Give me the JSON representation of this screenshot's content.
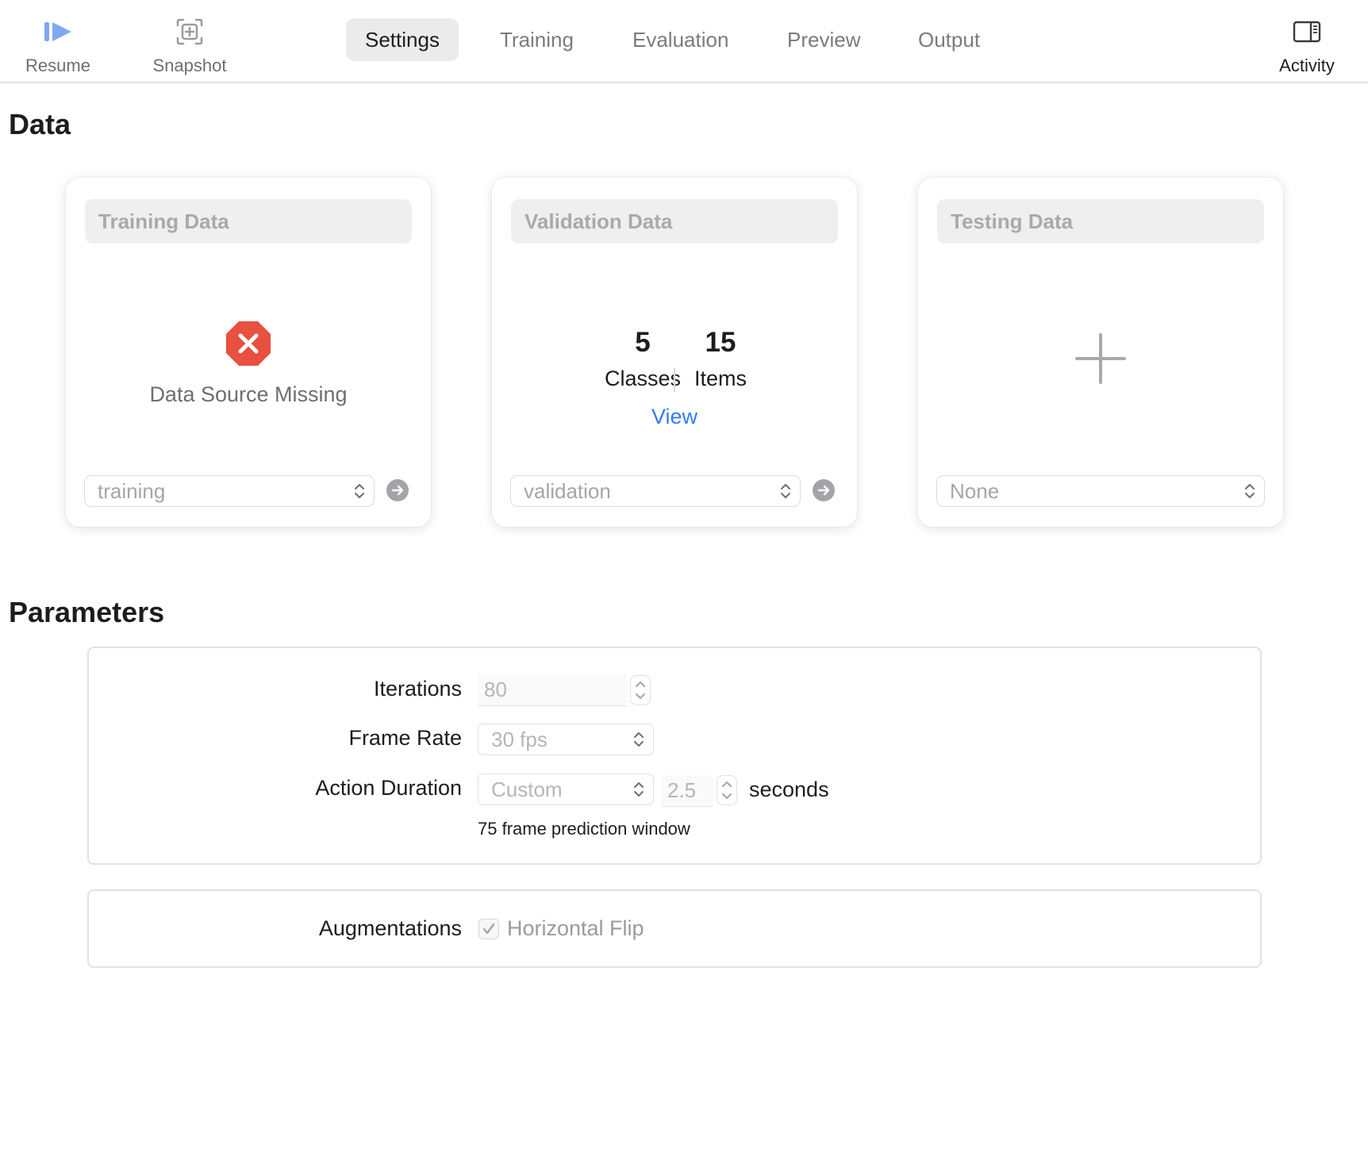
{
  "toolbar": {
    "resume_label": "Resume",
    "snapshot_label": "Snapshot",
    "activity_label": "Activity",
    "tabs": [
      "Settings",
      "Training",
      "Evaluation",
      "Preview",
      "Output"
    ],
    "active_tab": "Settings"
  },
  "data_section": {
    "title": "Data",
    "training": {
      "header": "Training Data",
      "message": "Data Source Missing",
      "source": "training"
    },
    "validation": {
      "header": "Validation Data",
      "classes_count": "5",
      "classes_label": "Classes",
      "items_count": "15",
      "items_label": "Items",
      "view_link": "View",
      "source": "validation"
    },
    "testing": {
      "header": "Testing Data",
      "source": "None"
    }
  },
  "parameters": {
    "title": "Parameters",
    "iterations_label": "Iterations",
    "iterations_value": "80",
    "frame_rate_label": "Frame Rate",
    "frame_rate_value": "30 fps",
    "action_duration_label": "Action Duration",
    "action_duration_mode": "Custom",
    "action_duration_value": "2.5",
    "action_duration_unit": "seconds",
    "prediction_window_note": "75 frame prediction window",
    "augmentations_label": "Augmentations",
    "horizontal_flip_label": "Horizontal Flip",
    "horizontal_flip_checked": true
  },
  "colors": {
    "accent": "#2f7cf6",
    "error": "#e8503f",
    "resume_icon": "#7fa8f4"
  }
}
